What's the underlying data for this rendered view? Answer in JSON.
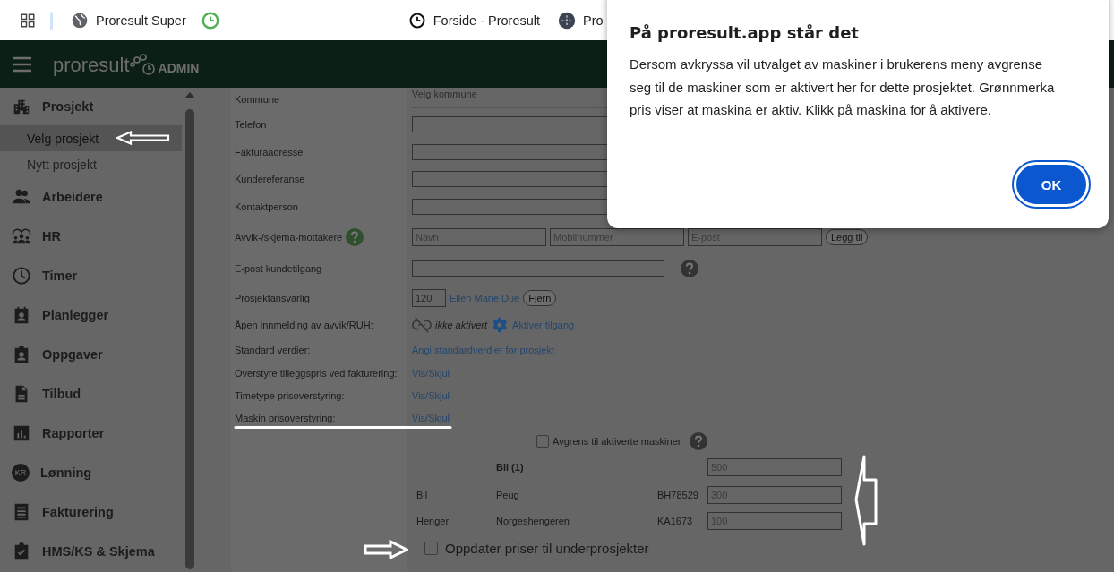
{
  "browser": {
    "tabs": [
      {
        "title": "Proresult Super"
      },
      {
        "title": "Forside - Proresult"
      },
      {
        "title": "Pro"
      }
    ]
  },
  "header": {
    "logo": "proresult",
    "badge": "ADMIN"
  },
  "sidebar": {
    "items": [
      {
        "label": "Prosjekt",
        "children": [
          {
            "label": "Velg prosjekt",
            "selected": true
          },
          {
            "label": "Nytt prosjekt",
            "selected": false
          }
        ]
      },
      {
        "label": "Arbeidere"
      },
      {
        "label": "HR"
      },
      {
        "label": "Timer"
      },
      {
        "label": "Planlegger"
      },
      {
        "label": "Oppgaver"
      },
      {
        "label": "Tilbud"
      },
      {
        "label": "Rapporter"
      },
      {
        "label": "Lønning",
        "icon_text": "KR"
      },
      {
        "label": "Fakturering"
      },
      {
        "label": "HMS/KS & Skjema"
      }
    ]
  },
  "form": {
    "rows": [
      {
        "kind": "select",
        "label": "Kommune",
        "placeholder": "Velg kommune"
      },
      {
        "kind": "input",
        "label": "Telefon"
      },
      {
        "kind": "input",
        "label": "Fakturaadresse"
      },
      {
        "kind": "input",
        "label": "Kundereferanse"
      },
      {
        "kind": "input",
        "label": "Kontaktperson"
      },
      {
        "kind": "recipients",
        "label": "Avvik-/skjema-mottakere",
        "placeholders": [
          "Navn",
          "Mobilnummer",
          "E-post"
        ],
        "button": "Legg til"
      },
      {
        "kind": "input-help",
        "label": "E-post kundetilgang"
      },
      {
        "kind": "manager",
        "label": "Prosjektansvarlig",
        "value": "120",
        "name": "Ellen Marie Due",
        "button": "Fjern"
      },
      {
        "kind": "access",
        "label": "Åpen innmelding av avvik/RUH:",
        "status": "ikke aktivert",
        "link": "Aktiver tilgang"
      },
      {
        "kind": "link",
        "label": "Standard verdier:",
        "link": "Angi standardverdier for prosjekt"
      },
      {
        "kind": "link",
        "label": "Overstyre tilleggspris ved fakturering:",
        "link": "Vis/Skjul"
      },
      {
        "kind": "link",
        "label": "Timetype prisoverstyring:",
        "link": "Vis/Skjul"
      },
      {
        "kind": "link",
        "label": "Maskin prisoverstyring:",
        "link": "Vis/Skjul"
      }
    ]
  },
  "machines": {
    "restrict": {
      "label": "Avgrens til aktiverte maskiner",
      "checked": false
    },
    "rows": [
      {
        "kind": "group",
        "name": "Bil (1)",
        "placeholder": "500"
      },
      {
        "kind": "machine",
        "type": "Bil",
        "name": "Peug",
        "reg": "BH78529",
        "placeholder": "300"
      },
      {
        "kind": "machine",
        "type": "Henger",
        "name": "Norgeshengeren",
        "reg": "KA1673",
        "placeholder": "100"
      }
    ],
    "update": {
      "label": "Oppdater priser til underprosjekter",
      "checked": false
    }
  },
  "dialog": {
    "title": "På proresult.app står det",
    "message": "Dersom avkryssa vil utvalget av maskiner i brukerens meny avgrense seg til de maskiner som er aktivert her for dette prosjektet. Grønnmerka pris viser at maskina er aktiv. Klikk på maskina for å aktivere.",
    "ok": "OK"
  }
}
